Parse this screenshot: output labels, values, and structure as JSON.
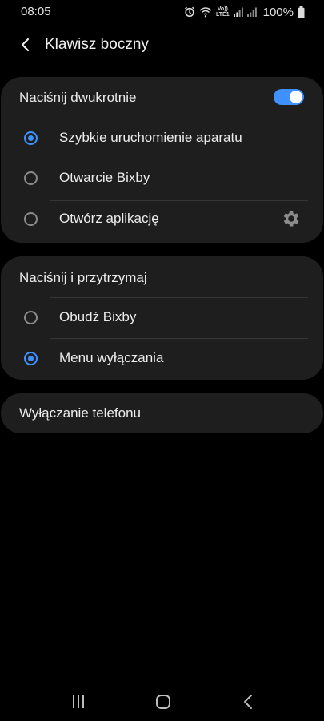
{
  "status_bar": {
    "time": "08:05",
    "volte_line1": "Vo))",
    "volte_line2": "LTE1",
    "battery": "100%"
  },
  "header": {
    "title": "Klawisz boczny"
  },
  "double_press": {
    "title": "Naciśnij dwukrotnie",
    "enabled": true,
    "options": [
      {
        "label": "Szybkie uruchomienie aparatu",
        "selected": true
      },
      {
        "label": "Otwarcie Bixby",
        "selected": false
      },
      {
        "label": "Otwórz aplikację",
        "selected": false
      }
    ]
  },
  "press_hold": {
    "title": "Naciśnij i przytrzymaj",
    "options": [
      {
        "label": "Obudź Bixby",
        "selected": false
      },
      {
        "label": "Menu wyłączania",
        "selected": true
      }
    ]
  },
  "power_off": {
    "label": "Wyłączanie telefonu"
  },
  "colors": {
    "accent": "#3e91ff",
    "card_background": "#1e1e1e",
    "page_background": "#000000"
  },
  "icons": {
    "back": "chevron-left-icon",
    "settings": "gear-icon",
    "nav_recent": "recent-apps-icon",
    "nav_home": "home-icon",
    "nav_back": "back-icon"
  }
}
